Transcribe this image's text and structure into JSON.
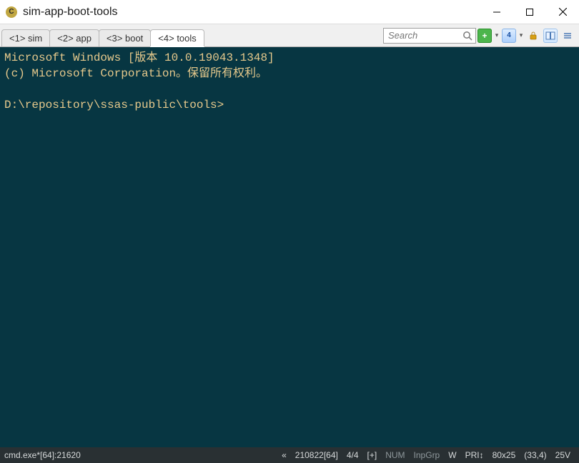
{
  "window": {
    "title": "sim-app-boot-tools"
  },
  "tabs": [
    {
      "label": "<1> sim",
      "active": false
    },
    {
      "label": "<2> app",
      "active": false
    },
    {
      "label": "<3> boot",
      "active": false
    },
    {
      "label": "<4> tools",
      "active": true
    }
  ],
  "search": {
    "placeholder": "Search"
  },
  "toolbar": {
    "new_glyph": "+",
    "num_label": "4"
  },
  "terminal": {
    "line1": "Microsoft Windows [版本 10.0.19043.1348]",
    "line2": "(c) Microsoft Corporation。保留所有权利。",
    "blank": "",
    "prompt": "D:\\repository\\ssas-public\\tools>"
  },
  "status": {
    "process": "cmd.exe*[64]:21620",
    "chevrons": "«",
    "build": "210822[64]",
    "index": "4/4",
    "sync": "[+]",
    "num": "NUM",
    "inpgrp": "InpGrp",
    "w": "W",
    "pri": "PRI↕",
    "size": "80x25",
    "cursor": "(33,4)",
    "volt": "25V"
  }
}
